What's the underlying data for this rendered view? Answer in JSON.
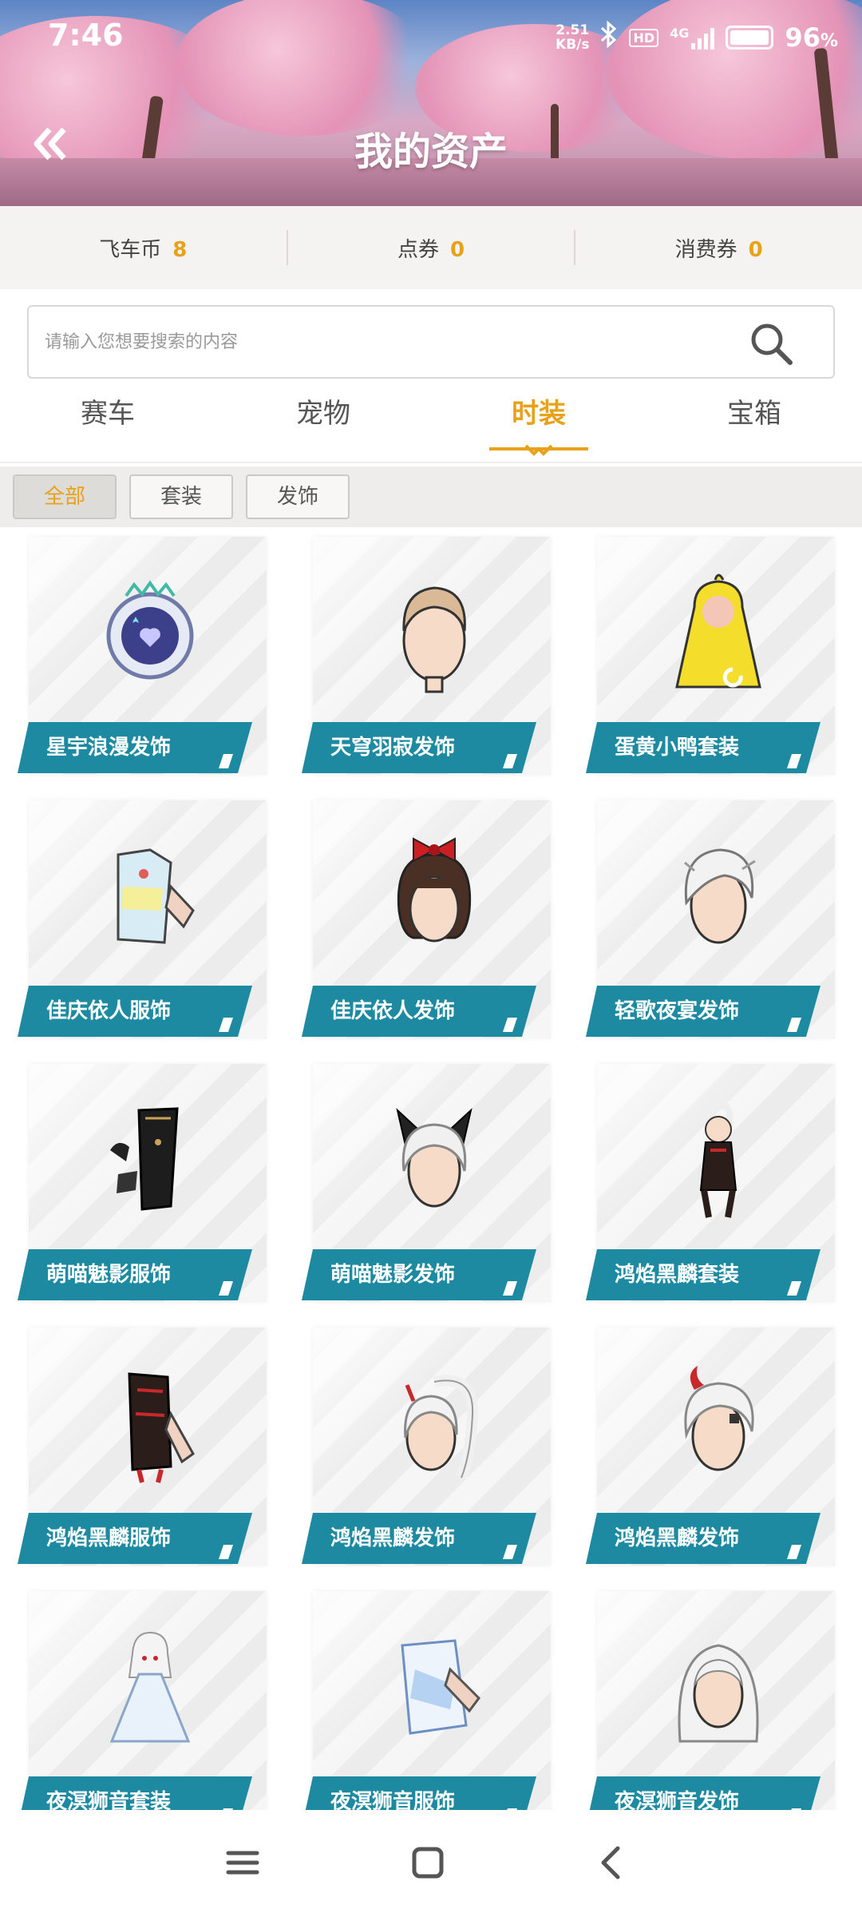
{
  "status_bar": {
    "time": "7:46",
    "net_speed_value": "2.51",
    "net_speed_unit": "KB/s",
    "bluetooth_icon": "bluetooth-icon",
    "hd_label": "HD",
    "network_label": "4G",
    "battery_percent": "96",
    "battery_unit": "%"
  },
  "header": {
    "title": "我的资产",
    "back_icon": "double-chevron-left-icon"
  },
  "currencies": [
    {
      "label": "飞车币",
      "value": "8"
    },
    {
      "label": "点券",
      "value": "0"
    },
    {
      "label": "消费券",
      "value": "0"
    }
  ],
  "search": {
    "placeholder": "请输入您想要搜索的内容",
    "icon": "search-icon"
  },
  "tabs": [
    {
      "label": "赛车",
      "active": false
    },
    {
      "label": "宠物",
      "active": false
    },
    {
      "label": "时装",
      "active": true
    },
    {
      "label": "宝箱",
      "active": false
    }
  ],
  "filters": [
    {
      "label": "全部",
      "active": true
    },
    {
      "label": "套装",
      "active": false
    },
    {
      "label": "发饰",
      "active": false
    }
  ],
  "items": [
    {
      "name": "星宇浪漫发饰",
      "icon": "astronaut-helmet-icon"
    },
    {
      "name": "天穹羽寂发饰",
      "icon": "short-hair-icon"
    },
    {
      "name": "蛋黄小鸭套装",
      "icon": "duck-costume-icon"
    },
    {
      "name": "佳庆依人服饰",
      "icon": "outfit-icon"
    },
    {
      "name": "佳庆依人发饰",
      "icon": "bow-hair-icon"
    },
    {
      "name": "轻歌夜宴发饰",
      "icon": "white-hair-icon"
    },
    {
      "name": "萌喵魅影服饰",
      "icon": "black-outfit-icon"
    },
    {
      "name": "萌喵魅影发饰",
      "icon": "cat-ear-hair-icon"
    },
    {
      "name": "鸿焰黑麟套装",
      "icon": "armor-costume-icon"
    },
    {
      "name": "鸿焰黑麟服饰",
      "icon": "armor-outfit-icon"
    },
    {
      "name": "鸿焰黑麟发饰",
      "icon": "ponytail-hair-icon"
    },
    {
      "name": "鸿焰黑麟发饰",
      "icon": "horn-hair-icon"
    },
    {
      "name": "夜溟狮音套装",
      "icon": "white-dress-costume-icon"
    },
    {
      "name": "夜溟狮音服饰",
      "icon": "white-outfit-icon"
    },
    {
      "name": "夜溟狮音发饰",
      "icon": "long-white-hair-icon"
    }
  ],
  "nav": {
    "menu_icon": "menu-icon",
    "home_icon": "home-square-icon",
    "back_icon": "back-chevron-icon"
  }
}
